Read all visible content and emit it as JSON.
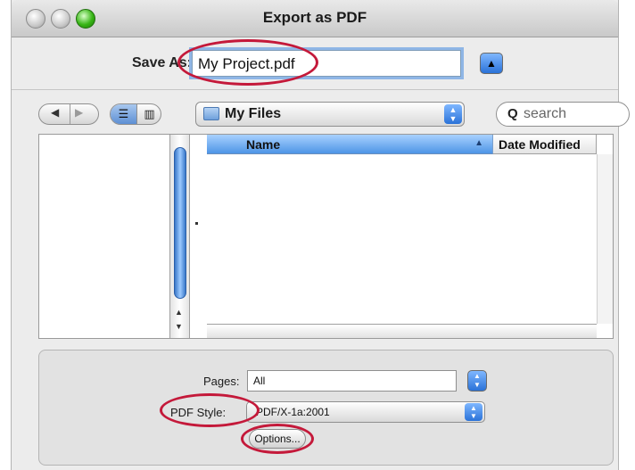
{
  "window": {
    "title": "Export as PDF"
  },
  "save": {
    "label": "Save As:",
    "value": "My Project.pdf",
    "expand_icon": "triangle-up-icon"
  },
  "toolbar": {
    "back_icon": "chevron-left-icon",
    "forward_icon": "chevron-right-icon",
    "list_view_icon": "list-view-icon",
    "column_view_icon": "column-view-icon",
    "location": "My Files",
    "search_placeholder": "search"
  },
  "browser": {
    "columns": [
      "Name",
      "Date Modified"
    ],
    "sort_column": "Name",
    "files": []
  },
  "options": {
    "pages_label": "Pages:",
    "pages_value": "All",
    "style_label": "PDF Style:",
    "style_value": "PDF/X-1a:2001",
    "options_button": "Options..."
  },
  "colors": {
    "highlight_ring": "#c4193a",
    "accent": "#2a72d8",
    "selected_header": "#4e95e6"
  }
}
